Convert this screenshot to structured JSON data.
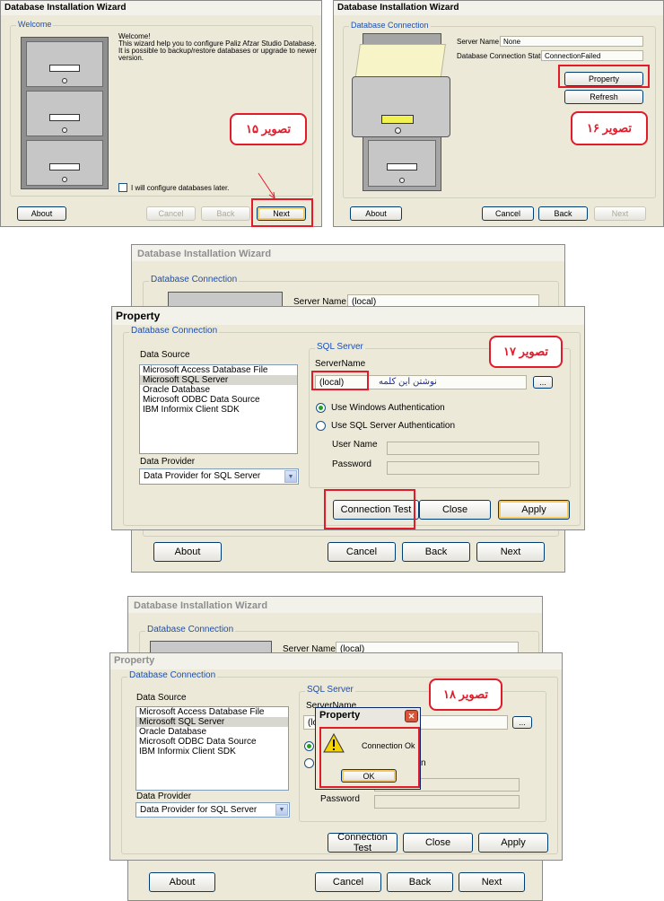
{
  "panel15": {
    "title": "Database Installation Wizard",
    "group": "Welcome",
    "welcome_lines": [
      "Welcome!",
      "This wizard help you to configure Paliz Afzar Studio Database.",
      "It is possible to backup/restore databases or upgrade to newer",
      "version."
    ],
    "checkbox_label": "I will configure databases later.",
    "about": "About",
    "cancel": "Cancel",
    "back": "Back",
    "next": "Next",
    "callout": "تصویر ۱۵"
  },
  "panel16": {
    "title": "Database Installation Wizard",
    "group": "Database Connection",
    "server_name_label": "Server Name",
    "server_name_value": "None",
    "status_label": "Database Connection Status",
    "status_value": "ConnectionFailed",
    "property": "Property",
    "refresh": "Refresh",
    "about": "About",
    "cancel": "Cancel",
    "back": "Back",
    "next": "Next",
    "callout": "تصویر ۱۶"
  },
  "panel17": {
    "bg_title": "Database Installation Wizard",
    "bg_group": "Database Connection",
    "bg_server_label": "Server Name",
    "bg_server_value": "(local)",
    "title": "Property",
    "group": "Database Connection",
    "data_source_label": "Data Source",
    "data_sources": [
      "Microsoft Access Database File",
      "Microsoft SQL Server",
      "Oracle Database",
      "Microsoft ODBC Data Source",
      "IBM Informix Client SDK"
    ],
    "selected_index": 1,
    "data_provider_label": "Data Provider",
    "data_provider_value": "Data Provider for SQL Server",
    "sql_group": "SQL Server",
    "server_name_label": "ServerName",
    "server_name_value": "(local)",
    "annotation": "نوشتن این کلمه",
    "browse": "...",
    "win_auth": "Use Windows Authentication",
    "sql_auth": "Use SQL Server Authentication",
    "user_name": "User Name",
    "password": "Password",
    "connection_test": "Connection Test",
    "close": "Close",
    "apply": "Apply",
    "about": "About",
    "cancel": "Cancel",
    "back": "Back",
    "next": "Next",
    "callout": "تصویر ۱۷"
  },
  "panel18": {
    "bg_title": "Database Installation Wizard",
    "bg_group": "Database Connection",
    "bg_server_label": "Server Name",
    "bg_server_value": "(local)",
    "title": "Property",
    "group": "Database Connection",
    "data_source_label": "Data Source",
    "data_sources": [
      "Microsoft Access Database File",
      "Microsoft SQL Server",
      "Oracle Database",
      "Microsoft ODBC Data Source",
      "IBM Informix Client SDK"
    ],
    "selected_index": 1,
    "data_provider_label": "Data Provider",
    "data_provider_value": "Data Provider for SQL Server",
    "sql_group": "SQL Server",
    "server_name_label": "ServerName",
    "server_name_value": "(lo",
    "browse": "...",
    "auth_partial": "n",
    "password": "Password",
    "connection_test": "Connection Test",
    "close": "Close",
    "apply": "Apply",
    "about": "About",
    "cancel": "Cancel",
    "back": "Back",
    "next": "Next",
    "msg_title": "Property",
    "msg_text": "Connection Ok",
    "msg_ok": "OK",
    "callout": "تصویر ۱۸"
  }
}
